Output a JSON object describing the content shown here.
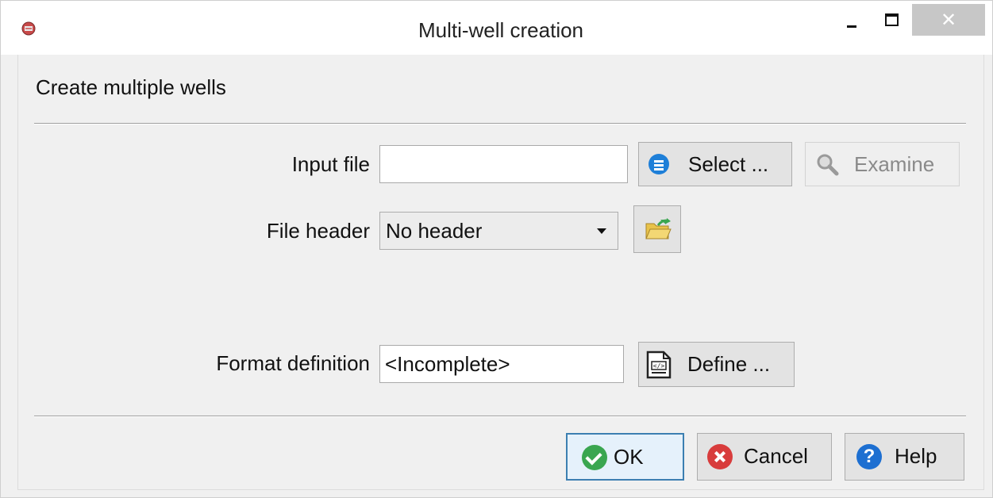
{
  "window": {
    "title": "Multi-well creation",
    "minimize_icon": "minimize-icon",
    "maximize_icon": "maximize-icon",
    "close_glyph": "✕"
  },
  "dialog": {
    "subtitle": "Create multiple wells",
    "input_file": {
      "label": "Input file",
      "value": ""
    },
    "select_button": {
      "label": "Select ...",
      "icon": "list-icon"
    },
    "examine_button": {
      "label": "Examine",
      "icon": "magnifier-icon",
      "enabled": false
    },
    "file_header": {
      "label": "File header",
      "selected": "No header",
      "open_button_icon": "open-folder-icon"
    },
    "format_definition": {
      "label": "Format definition",
      "value": "<Incomplete>"
    },
    "define_button": {
      "label": "Define ...",
      "icon": "document-code-icon"
    }
  },
  "footer": {
    "ok_label": "OK",
    "cancel_label": "Cancel",
    "help_label": "Help",
    "help_glyph": "?"
  },
  "colors": {
    "accent_blue": "#1e7fd8",
    "ok_green": "#3aa650",
    "cancel_red": "#d83c3c",
    "focus_border": "#3c7fb1"
  }
}
